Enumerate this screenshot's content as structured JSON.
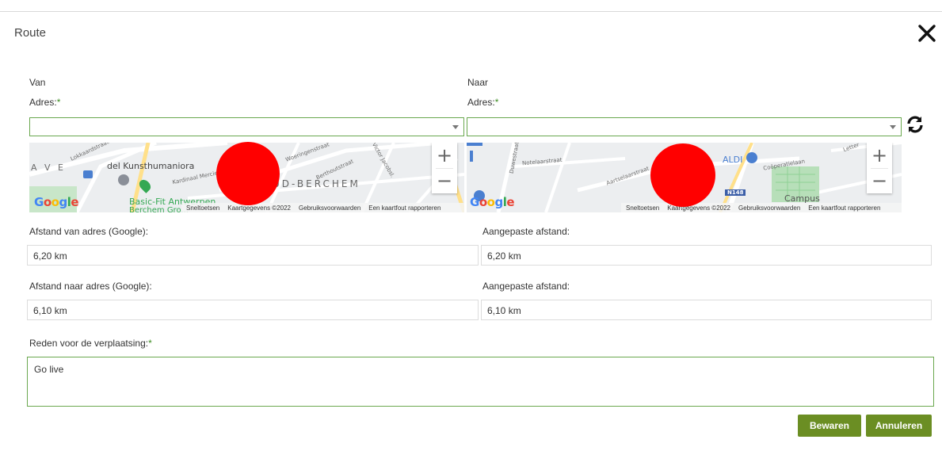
{
  "dialog": {
    "title": "Route",
    "close_icon": "close-icon"
  },
  "from": {
    "heading": "Van",
    "address_label": "Adres:",
    "required_mark": "*",
    "address_value": "",
    "map": {
      "labels": [
        "A V E",
        "Lokkaardstraat",
        "del Kunsthumaniora",
        "Kardinaal Mercier",
        "Woeringenstraat",
        "Berthoutstraat",
        "Victor Jacobsl.",
        "UD-BERCHEM",
        "Basic-Fit Antwerpen",
        "Berchem Gro..."
      ],
      "google": "Google",
      "footer": [
        "Sneltoetsen",
        "Kaartgegevens ©2022",
        "Gebruiksvoorwaarden",
        "Een kaartfout rapporteren"
      ]
    }
  },
  "to": {
    "heading": "Naar",
    "address_label": "Adres:",
    "required_mark": "*",
    "address_value": "",
    "map": {
      "labels": [
        "Notelaarstraat",
        "Aartselaarstraat",
        "Duwestraat",
        "ALDI",
        "Coöperatielaan",
        "N148",
        "Campus",
        "Letter"
      ],
      "google": "Google",
      "footer": [
        "Sneltoetsen",
        "Kaartgegevens ©2022",
        "Gebruiksvoorwaarden",
        "Een kaartfout rapporteren"
      ]
    }
  },
  "distances": {
    "from_google_label": "Afstand van adres (Google):",
    "from_google_value": "6,20 km",
    "from_adjusted_label": "Aangepaste afstand:",
    "from_adjusted_value": "6,20 km",
    "to_google_label": "Afstand naar adres (Google):",
    "to_google_value": "6,10 km",
    "to_adjusted_label": "Aangepaste afstand:",
    "to_adjusted_value": "6,10 km"
  },
  "reason": {
    "label": "Reden voor de verplaatsing:",
    "required_mark": "*",
    "value": "Go live"
  },
  "actions": {
    "save": "Bewaren",
    "cancel": "Annuleren"
  },
  "colors": {
    "accent_green": "#6b8e23",
    "input_border": "#6aa84f",
    "redaction": "#ff0000"
  },
  "icons": {
    "refresh": "refresh-icon",
    "zoom_in": "+",
    "zoom_out": "−"
  }
}
